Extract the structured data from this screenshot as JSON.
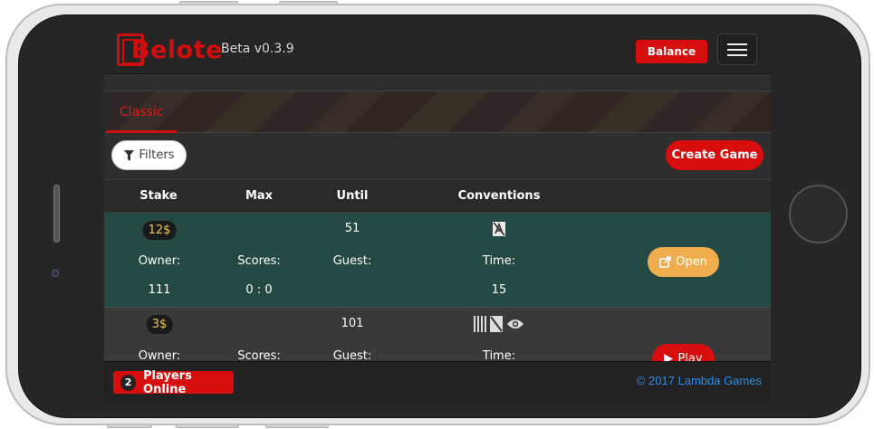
{
  "app": {
    "logo_text": "Belote",
    "version": "Beta v0.3.9"
  },
  "header": {
    "balance_label": "Balance",
    "menu_icon": "hamburger-icon"
  },
  "tabs": [
    {
      "label": "Classic",
      "active": true
    }
  ],
  "toolbar": {
    "filters_label": "Filters",
    "filters_icon": "filter-icon",
    "create_label": "Create Game"
  },
  "table": {
    "headers": {
      "stake": "Stake",
      "max": "Max",
      "until": "Until",
      "conventions": "Conventions"
    },
    "rows": [
      {
        "stake": "12$",
        "until": "51",
        "conventions_icons": [
          "no-trump-icon"
        ],
        "owner_label": "Owner:",
        "owner": "111",
        "scores_label": "Scores:",
        "scores": "0 : 0",
        "guest_label": "Guest:",
        "guest": "",
        "time_label": "Time:",
        "time": "15",
        "action": "Open",
        "action_icon": "external-link-icon"
      },
      {
        "stake": "3$",
        "until": "101",
        "conventions_icons": [
          "barcode-icon",
          "no-trump-icon",
          "eye-icon"
        ],
        "owner_label": "Owner:",
        "scores_label": "Scores:",
        "guest_label": "Guest:",
        "time_label": "Time:",
        "action": "Play",
        "action_icon": "play-icon"
      }
    ]
  },
  "footer": {
    "online_count": "2",
    "online_label": "Players Online",
    "copyright": "2017 Lambda Games",
    "copyright_symbol": "©"
  },
  "colors": {
    "brand_red": "#d80e0e",
    "row_green": "#244a43",
    "open_orange": "#f0ad4e",
    "stake_gold": "#f2c644",
    "link_blue": "#2a8ee8"
  }
}
